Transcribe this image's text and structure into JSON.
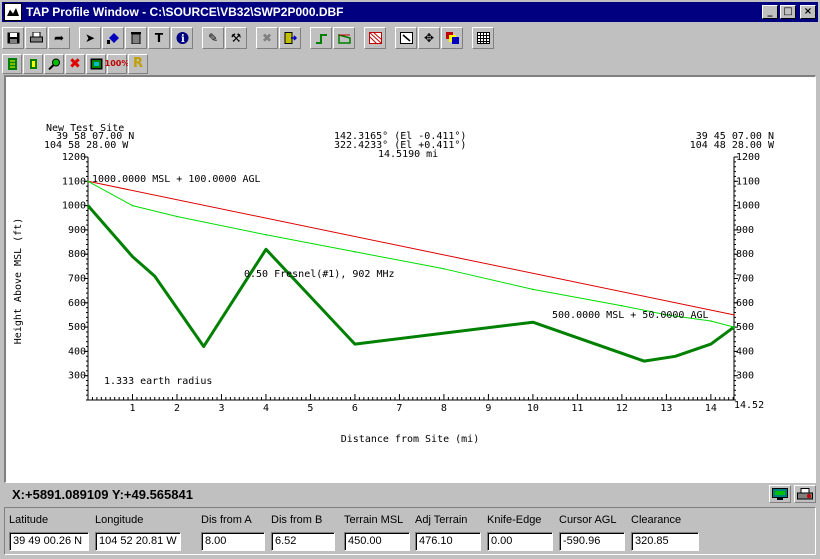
{
  "window": {
    "title": "TAP Profile Window - C:\\SOURCE\\VB32\\SWP2P000.DBF"
  },
  "colors": {
    "titlebar": "#000080",
    "terrain": "#008000",
    "fresnel": "#00dd00",
    "los_line": "#dd0000"
  },
  "toolbar1": [
    "save-icon",
    "print-icon",
    "redo-arrow-icon",
    "pointer-icon",
    "paint-bucket-icon",
    "delete-icon",
    "text-tool-icon",
    "info-icon",
    "measure-tool-icon",
    "wrench-icon",
    "cross-disabled-icon",
    "exit-door-icon",
    "step-profile-icon",
    "folder-profile-icon",
    "hatch-pattern-icon",
    "zoom-box-icon",
    "move-crosshair-icon",
    "color-palette-icon",
    "grid-icon"
  ],
  "toolbar2": [
    "site-a-icon",
    "site-b-icon",
    "magnify-icon",
    "red-x-icon",
    "image-icon",
    "zoom-100-icon",
    "r-tool-icon"
  ],
  "plot": {
    "site_a": {
      "name": "New Test Site",
      "lat": "39 58 07.00 N",
      "lon": "104 58 28.00 W"
    },
    "site_b": {
      "lat": "39 45 07.00 N",
      "lon": "104 48 28.00 W"
    },
    "azimuth_line1": "142.3165° (El -0.411°)",
    "azimuth_line2": "322.4233° (El +0.411°)",
    "distance": "14.5190 mi",
    "label_a": "1000.0000 MSL + 100.0000 AGL",
    "label_b": "500.0000 MSL + 50.0000 AGL",
    "fresnel_label": "0.50 Fresnel(#1), 902 MHz",
    "earth_label": "1.333 earth radius",
    "end_distance": "14.52"
  },
  "chart_data": {
    "type": "line",
    "xlabel": "Distance from Site (mi)",
    "ylabel": "Height Above MSL (ft)",
    "xlim": [
      0,
      14.52
    ],
    "ylim": [
      200,
      1200
    ],
    "x_ticks": [
      1,
      2,
      3,
      4,
      5,
      6,
      7,
      8,
      9,
      10,
      11,
      12,
      13,
      14
    ],
    "y_ticks": [
      300,
      400,
      500,
      600,
      700,
      800,
      900,
      1000,
      1100,
      1200
    ],
    "series": [
      {
        "color": "#008000",
        "x": [
          0,
          1,
          1.5,
          2.6,
          4.0,
          6.0,
          10.0,
          12.5,
          13.2,
          14.0,
          14.52
        ],
        "y": [
          1000,
          790,
          710,
          420,
          820,
          430,
          520,
          360,
          380,
          430,
          500
        ]
      },
      {
        "color": "#dd0000",
        "x": [
          0,
          14.52
        ],
        "y": [
          1100,
          550
        ]
      },
      {
        "color": "#00dd00",
        "x": [
          0,
          1,
          2,
          4,
          6,
          8,
          10,
          12,
          13,
          14,
          14.52
        ],
        "y": [
          1100,
          1000,
          955,
          880,
          810,
          740,
          655,
          588,
          550,
          525,
          500
        ]
      }
    ]
  },
  "coords": {
    "text": "X:+5891.089109 Y:+49.565841"
  },
  "coord_buttons": [
    "monitor-icon",
    "print-preview-icon"
  ],
  "info": {
    "latitude": {
      "label": "Latitude",
      "value": "39 49 00.26 N"
    },
    "longitude": {
      "label": "Longitude",
      "value": "104 52 20.81 W"
    },
    "dis_a": {
      "label": "Dis from A",
      "value": "8.00"
    },
    "dis_b": {
      "label": "Dis from B",
      "value": "6.52"
    },
    "terrain": {
      "label": "Terrain MSL",
      "value": "450.00"
    },
    "adj_terrain": {
      "label": "Adj Terrain",
      "value": "476.10"
    },
    "knife": {
      "label": "Knife-Edge",
      "value": "0.00"
    },
    "cursor_agl": {
      "label": "Cursor AGL",
      "value": "-590.96"
    },
    "clearance": {
      "label": "Clearance",
      "value": "320.85"
    }
  }
}
